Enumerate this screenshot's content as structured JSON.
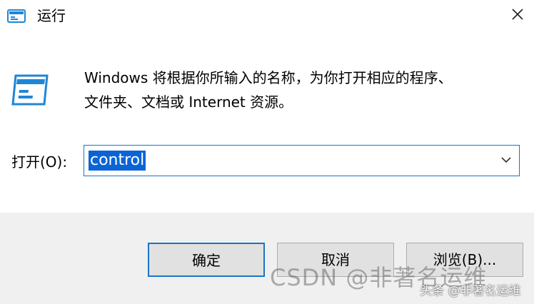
{
  "window": {
    "title": "运行",
    "title_icon": "run-dialog-icon",
    "close_icon": "close-icon"
  },
  "description": {
    "line1": "Windows 将根据你所输入的名称，为你打开相应的程序、",
    "line2": "文件夹、文档或 Internet 资源。"
  },
  "open_field": {
    "label": "打开(O):",
    "value": "control",
    "dropdown_icon": "chevron-down-icon"
  },
  "buttons": {
    "ok": "确定",
    "cancel": "取消",
    "browse": "浏览(B)..."
  },
  "watermark": {
    "text": "CSDN @非著名运维",
    "caption": "头条 @非著名运维"
  },
  "colors": {
    "accent": "#1a73c8",
    "selection": "#0a64d6",
    "footer_bg": "#f0f0f0"
  }
}
